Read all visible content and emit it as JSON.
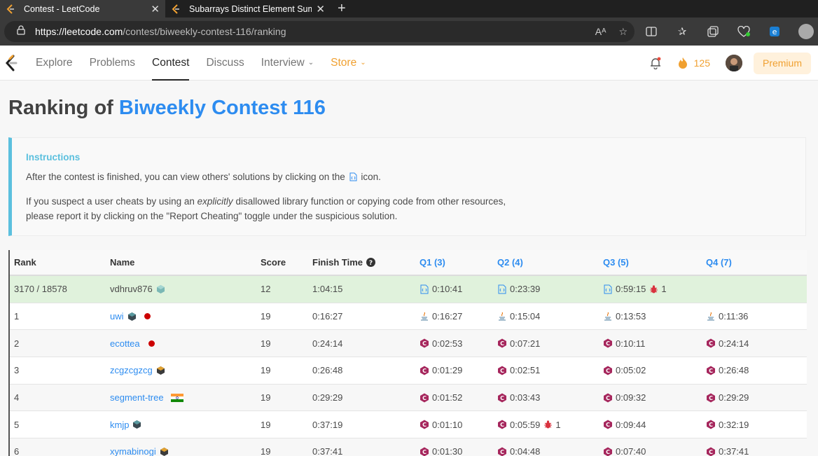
{
  "browser": {
    "tabs": [
      {
        "title": "Contest - LeetCode",
        "active": true
      },
      {
        "title": "Subarrays Distinct Element Sum c",
        "active": false
      }
    ],
    "url_host": "https://leetcode.com",
    "url_path": "/contest/biweekly-contest-116/ranking"
  },
  "nav": {
    "items": [
      "Explore",
      "Problems",
      "Contest",
      "Discuss",
      "Interview",
      "Store"
    ],
    "active": "Contest",
    "streak": "125",
    "premium": "Premium"
  },
  "page": {
    "title_prefix": "Ranking of",
    "title_contest": "Biweekly Contest 116"
  },
  "instructions": {
    "heading": "Instructions",
    "line1_a": "After the contest is finished, you can view others' solutions by clicking on the",
    "line1_b": "icon.",
    "line2_a": "If you suspect a user cheats by using an",
    "line2_em": "explicitly",
    "line2_b": "disallowed library function or copying code from other resources,",
    "line3": "please report it by clicking on the \"Report Cheating\" toggle under the suspicious solution."
  },
  "table": {
    "headers": {
      "rank": "Rank",
      "name": "Name",
      "score": "Score",
      "finish": "Finish Time",
      "q1": "Q1 (3)",
      "q2": "Q2 (4)",
      "q3": "Q3 (5)",
      "q4": "Q4 (7)"
    },
    "rows": [
      {
        "rank": "3170 / 18578",
        "name": "vdhruv876",
        "score": "12",
        "finish": "1:04:15",
        "q1": "0:10:41",
        "q2": "0:23:39",
        "q3": "0:59:15",
        "q3_bug": "1",
        "q4": ""
      },
      {
        "rank": "1",
        "name": "uwi",
        "score": "19",
        "finish": "0:16:27",
        "q1": "0:16:27",
        "q2": "0:15:04",
        "q3": "0:13:53",
        "q4": "0:11:36"
      },
      {
        "rank": "2",
        "name": "ecottea",
        "score": "19",
        "finish": "0:24:14",
        "q1": "0:02:53",
        "q2": "0:07:21",
        "q3": "0:10:11",
        "q4": "0:24:14"
      },
      {
        "rank": "3",
        "name": "zcgzcgzcg",
        "score": "19",
        "finish": "0:26:48",
        "q1": "0:01:29",
        "q2": "0:02:51",
        "q3": "0:05:02",
        "q4": "0:26:48"
      },
      {
        "rank": "4",
        "name": "segment-tree",
        "score": "19",
        "finish": "0:29:29",
        "q1": "0:01:52",
        "q2": "0:03:43",
        "q3": "0:09:32",
        "q4": "0:29:29"
      },
      {
        "rank": "5",
        "name": "kmjp",
        "score": "19",
        "finish": "0:37:19",
        "q1": "0:01:10",
        "q2": "0:05:59",
        "q2_bug": "1",
        "q3": "0:09:44",
        "q4": "0:32:19"
      },
      {
        "rank": "6",
        "name": "xymabinogi",
        "score": "19",
        "finish": "0:37:41",
        "q1": "0:01:30",
        "q2": "0:04:48",
        "q3": "0:07:40",
        "q4": "0:37:41"
      }
    ]
  },
  "colors": {
    "accent": "#2d8cf0",
    "store": "#f0a030",
    "info": "#5bc0de",
    "my_row": "#e0f2dc"
  }
}
